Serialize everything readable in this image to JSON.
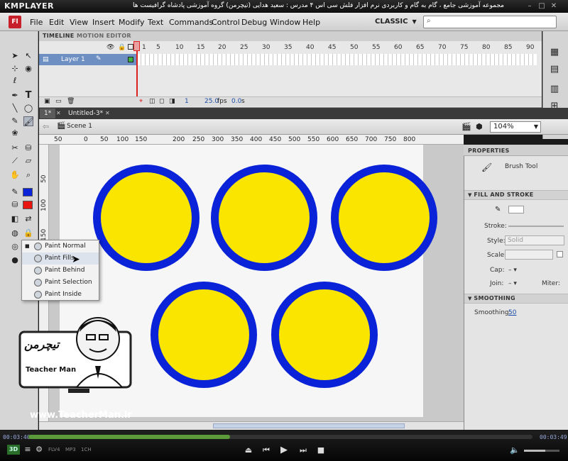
{
  "player": {
    "logo": "KMPLAYER",
    "caption": "مجموعه آموزشی جامع ، گام به گام و کاربردی نرم افزار فلش سی اس ۴ مدرس : سعید هدایی (تیچرمن) گروه آموزشی پادشاه گرافیست ها",
    "time_left": "00:03:40",
    "time_right": "00:03:49",
    "progress": 0.4,
    "badges": [
      "FLV4",
      "MP3",
      "1CH"
    ],
    "mode_3d": "3D"
  },
  "app": {
    "logo": "Fl",
    "menu": [
      "File",
      "Edit",
      "View",
      "Insert",
      "Modify",
      "Text",
      "Commands",
      "Control",
      "Debug",
      "Window",
      "Help"
    ],
    "workspace": "CLASSIC"
  },
  "timeline": {
    "tabs": [
      "TIMELINE",
      "MOTION EDITOR"
    ],
    "layer_name": "Layer 1",
    "frame_numbers": [
      "1",
      "5",
      "10",
      "15",
      "20",
      "25",
      "30",
      "35",
      "40",
      "45",
      "50",
      "55",
      "60",
      "65",
      "70",
      "75",
      "80",
      "85",
      "90"
    ],
    "current_frame": "1",
    "fps": "25.0",
    "fps_unit": "fps",
    "time": "0.0",
    "time_unit": "s"
  },
  "documents": {
    "tabs": [
      "1*",
      "Untitled-3*"
    ],
    "scene": "Scene 1",
    "zoom": "104%"
  },
  "rulers": {
    "horizontal": [
      "50",
      "0",
      "50",
      "100",
      "150",
      "200",
      "250",
      "300",
      "350",
      "400",
      "450",
      "500",
      "550",
      "600",
      "650",
      "700",
      "750",
      "800"
    ],
    "vertical": [
      "50",
      "100",
      "150"
    ]
  },
  "brush_menu": {
    "items": [
      "Paint Normal",
      "Paint Fills",
      "Paint Behind",
      "Paint Selection",
      "Paint Inside"
    ],
    "checked": "Paint Normal"
  },
  "properties": {
    "tab": "PROPERTIES",
    "tool_name": "Brush Tool",
    "section_fill": "FILL AND STROKE",
    "stroke_label": "Stroke:",
    "style_label": "Style:",
    "style_value": "Solid",
    "scale_label": "Scale:",
    "cap_label": "Cap:",
    "join_label": "Join:",
    "miter_label": "Miter:",
    "section_smoothing": "SMOOTHING",
    "smoothing_label": "Smoothing:",
    "smoothing_value": "50"
  },
  "colors": {
    "circle_fill": "#f9e500",
    "circle_stroke": "#0a22d8",
    "stroke_swatch": "#0a22d8",
    "fill_swatch": "#e8140f"
  },
  "watermark": {
    "logo_text": "تیچرمن",
    "name": "Teacher Man",
    "url": "www.TeacherMan.ir"
  }
}
